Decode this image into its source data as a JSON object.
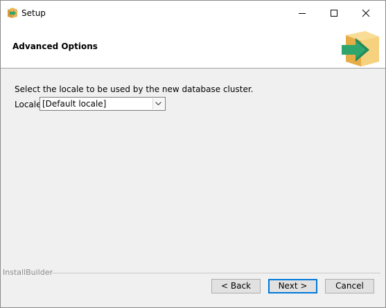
{
  "window": {
    "title": "Setup",
    "icon": "installer-box-icon"
  },
  "titlebar_controls": {
    "minimize_icon": "minimize-icon",
    "maximize_icon": "maximize-icon",
    "close_icon": "close-icon"
  },
  "header": {
    "title": "Advanced Options",
    "logo": "installer-box-arrow-icon"
  },
  "main": {
    "instruction": "Select the locale to be used by the new database cluster.",
    "locale_label": "Locale",
    "locale_select": {
      "value": "[Default locale]"
    }
  },
  "footer": {
    "brand_label": "InstallBuilder",
    "back_label": "< Back",
    "next_label": "Next >",
    "cancel_label": "Cancel"
  },
  "colors": {
    "accent": "#0078d7",
    "window_bg": "#f0f0f0",
    "logo_box": "#f0c060",
    "logo_arrow": "#2ea56d"
  }
}
